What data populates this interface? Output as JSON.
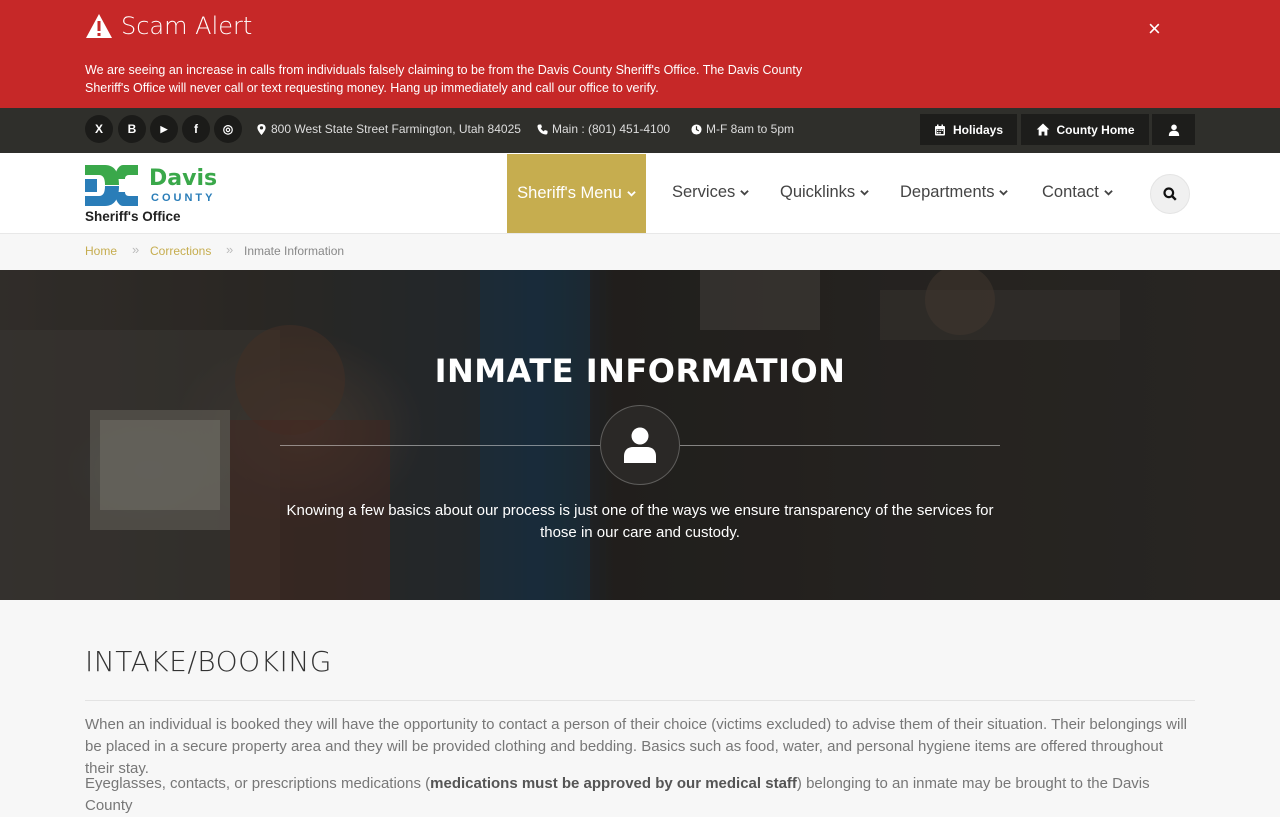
{
  "alert": {
    "title": "Scam Alert",
    "message": "We are seeing an increase in calls from individuals falsely claiming to be from the Davis County Sheriff's Office. The Davis County Sheriff's Office will never call or text requesting money. Hang up immediately and call our office to verify.",
    "close": "×",
    "color": "#c62828"
  },
  "topbar": {
    "social": [
      {
        "icon": "x-icon",
        "glyph": "X"
      },
      {
        "icon": "blogger-icon",
        "glyph": "B"
      },
      {
        "icon": "youtube-icon",
        "glyph": "▶"
      },
      {
        "icon": "facebook-icon",
        "glyph": "f"
      },
      {
        "icon": "instagram-icon",
        "glyph": "◎"
      }
    ],
    "address": "800 West State Street Farmington, Utah 84025",
    "phone": "Main : (801) 451-4100",
    "hours": "M-F 8am to 5pm",
    "holidays": "Holidays",
    "county_home": "County Home"
  },
  "logo": {
    "davis": "Davis",
    "county": "COUNTY",
    "office": "Sheriff's Office"
  },
  "nav": {
    "items": [
      "Sheriff's Menu",
      "Services",
      "Quicklinks",
      "Departments",
      "Contact"
    ],
    "active_color": "#c6ad4f"
  },
  "breadcrumb": {
    "home": "Home",
    "section": "Corrections",
    "current": "Inmate Information"
  },
  "hero": {
    "title": "INMATE INFORMATION",
    "subtitle": "Knowing a few basics about our process is just one of the ways we ensure transparency of the services for those in our care and custody."
  },
  "content": {
    "heading": "INTAKE/BOOKING",
    "p1": "When an individual is booked they will have the opportunity to contact a person of their choice (victims excluded) to advise them of their situation. Their belongings will be placed in a secure property area and they will be provided clothing and bedding. Basics such as food, water, and personal hygiene items are offered throughout their stay.",
    "p2_start": "Eyeglasses, contacts, or prescriptions medications (",
    "p2_bold": "medications must be approved by our medical staff",
    "p2_end": ") belonging to an inmate may be brought to the Davis County"
  }
}
